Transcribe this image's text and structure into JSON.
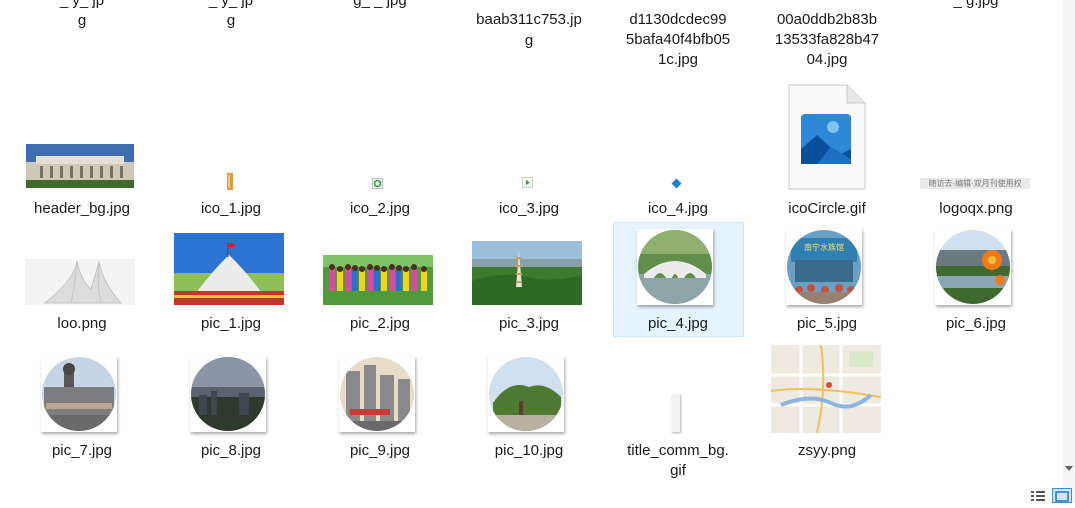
{
  "top_row": [
    {
      "lines": [
        "_ y_ jp",
        "g"
      ]
    },
    {
      "lines": [
        "_ y_ jp",
        "g"
      ]
    },
    {
      "lines": [
        "g_ _ jpg"
      ]
    },
    {
      "lines": [
        "baab311c753.jp",
        "g"
      ]
    },
    {
      "lines": [
        "d1130dcdec99",
        "5bafa40f4bfb05",
        "1c.jpg"
      ]
    },
    {
      "lines": [
        "00a0ddb2b83b",
        "13533fa828b47",
        "04.jpg"
      ]
    },
    {
      "lines": [
        "_ g.jpg"
      ]
    }
  ],
  "row1": [
    {
      "name": "header_bg.jpg"
    },
    {
      "name": "ico_1.jpg"
    },
    {
      "name": "ico_2.jpg"
    },
    {
      "name": "ico_3.jpg"
    },
    {
      "name": "ico_4.jpg"
    },
    {
      "name": "icoCircle.gif"
    },
    {
      "name": "logoqx.png",
      "thumb_text": "随访去·编辑·双月刊使用权"
    }
  ],
  "row2": [
    {
      "name": "loo.png"
    },
    {
      "name": "pic_1.jpg"
    },
    {
      "name": "pic_2.jpg"
    },
    {
      "name": "pic_3.jpg"
    },
    {
      "name": "pic_4.jpg",
      "selected": true
    },
    {
      "name": "pic_5.jpg",
      "thumb_text": "南宁水族馆"
    },
    {
      "name": "pic_6.jpg"
    }
  ],
  "row3": [
    {
      "name": "pic_7.jpg"
    },
    {
      "name": "pic_8.jpg"
    },
    {
      "name": "pic_9.jpg"
    },
    {
      "name": "pic_10.jpg"
    },
    {
      "name_lines": [
        "title_comm_bg.",
        "gif"
      ]
    },
    {
      "name": "zsyy.png"
    }
  ],
  "view_icons": [
    "details-view-icon",
    "large-icons-view-icon"
  ],
  "colors": {
    "selection_bg": "#e5f3ff",
    "selection_border": "#cce8ff",
    "photos_icon": "#2f87d8"
  }
}
